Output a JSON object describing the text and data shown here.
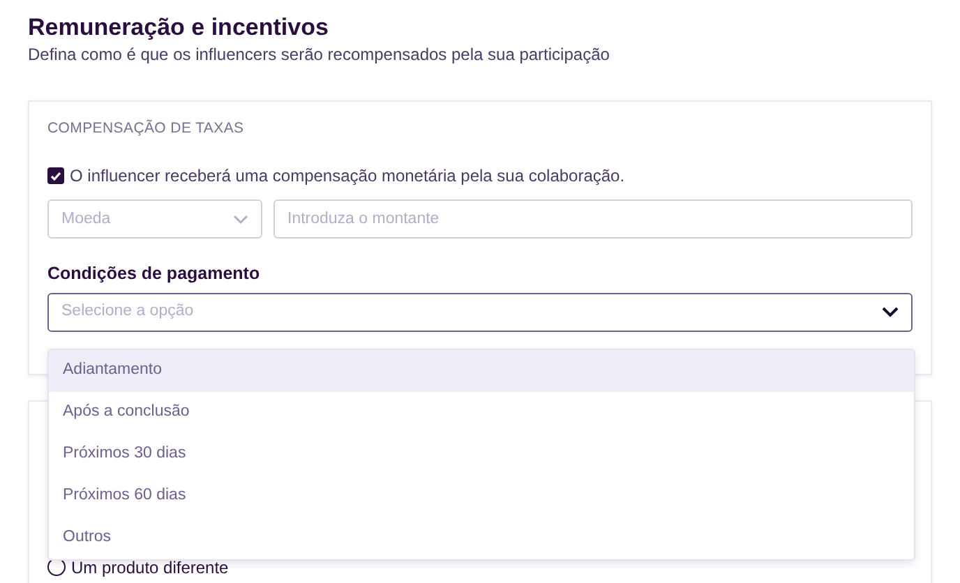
{
  "header": {
    "title": "Remuneração e incentivos",
    "subtitle": "Defina como é que os influencers serão recompensados pela sua participação"
  },
  "fee_card": {
    "section_label": "COMPENSAÇÃO DE TAXAS",
    "checkbox": {
      "label": "O influencer receberá uma compensação monetária pela sua colaboração.",
      "checked": true
    },
    "currency": {
      "placeholder": "Moeda"
    },
    "amount": {
      "placeholder": "Introduza o montante"
    },
    "payment_terms": {
      "label": "Condições de pagamento",
      "placeholder": "Selecione a opção",
      "expanded": true,
      "options": [
        {
          "label": "Adiantamento",
          "selected": true
        },
        {
          "label": "Após a conclusão",
          "selected": false
        },
        {
          "label": "Próximos 30 dias",
          "selected": false
        },
        {
          "label": "Próximos 60 dias",
          "selected": false
        },
        {
          "label": "Outros",
          "selected": false
        }
      ]
    }
  },
  "second_card": {
    "radio": {
      "label": "Um produto diferente",
      "checked": false
    }
  }
}
